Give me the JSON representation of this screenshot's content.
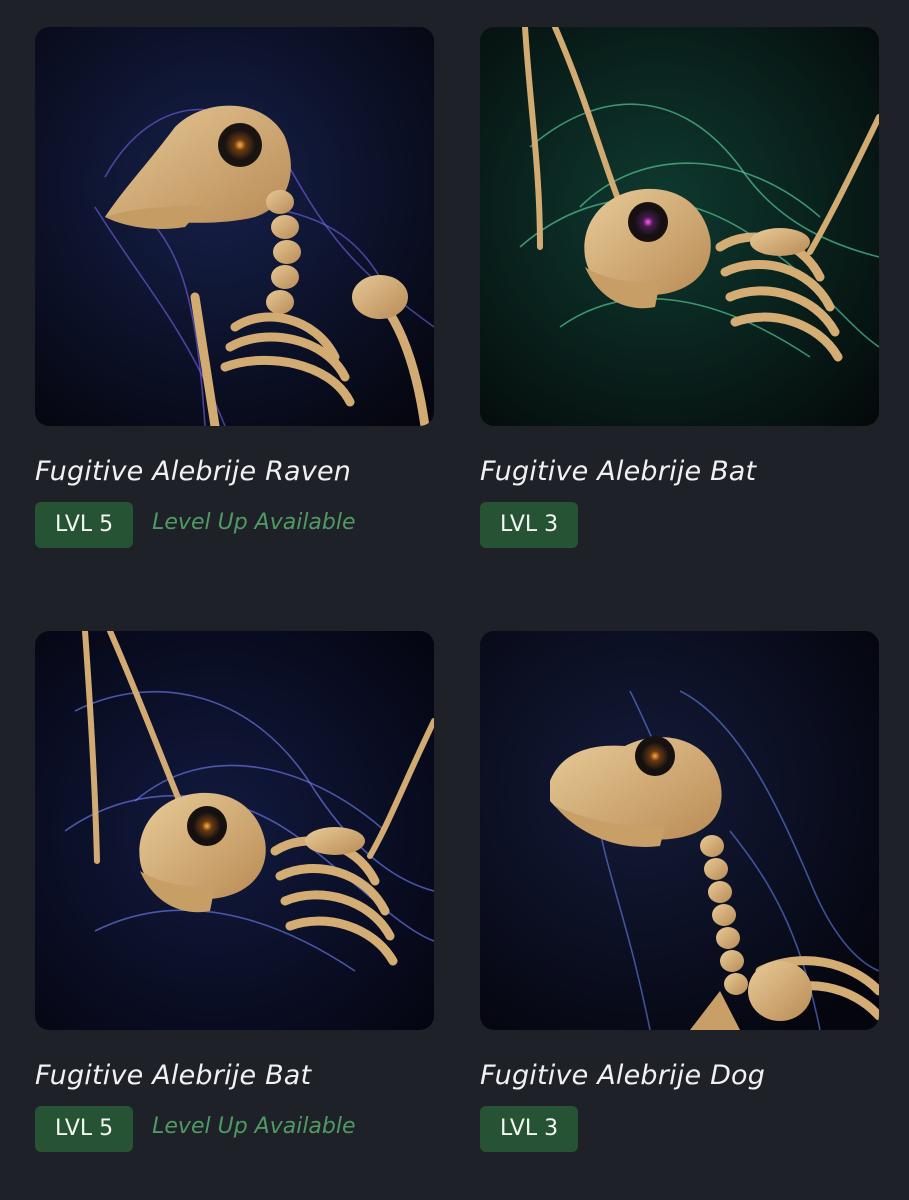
{
  "cards": [
    {
      "title": "Fugitive Alebrije Raven",
      "level": "LVL 5",
      "status": "Level Up Available",
      "art_icon": "raven-skeleton-icon",
      "glow_color": "#7e6cff",
      "bg_color": "#0b1024"
    },
    {
      "title": "Fugitive Alebrije Bat",
      "level": "LVL 3",
      "status": "",
      "art_icon": "bat-skeleton-icon",
      "glow_color": "#58d6a0",
      "bg_color": "#0b2420"
    },
    {
      "title": "Fugitive Alebrije Bat",
      "level": "LVL 5",
      "status": "Level Up Available",
      "art_icon": "bat-skeleton-icon",
      "glow_color": "#6f7dff",
      "bg_color": "#0a0f22"
    },
    {
      "title": "Fugitive Alebrije Dog",
      "level": "LVL 3",
      "status": "",
      "art_icon": "dog-skeleton-icon",
      "glow_color": "#5f86ff",
      "bg_color": "#0a1024"
    }
  ],
  "colors": {
    "page_bg": "#1f2128",
    "badge_bg": "#275335",
    "levelup_text": "#4e9a62"
  }
}
